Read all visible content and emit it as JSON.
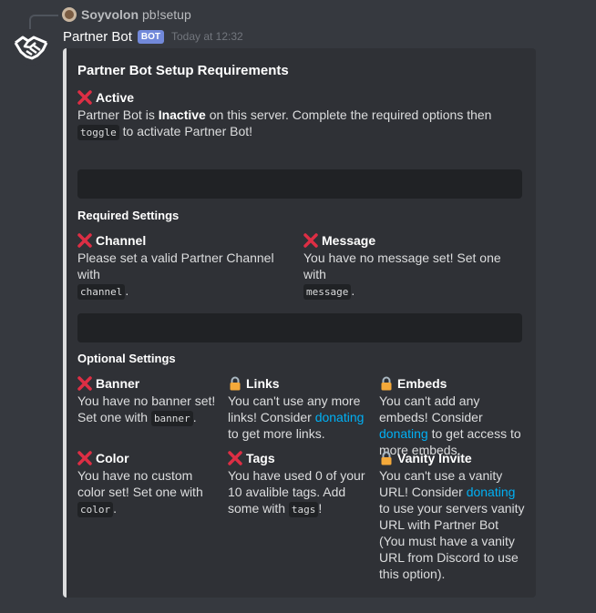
{
  "reply": {
    "author": "Soyvolon",
    "text": "pb!setup"
  },
  "message": {
    "author": "Partner Bot",
    "bot_tag": "BOT",
    "timestamp": "Today at 12:32"
  },
  "embed": {
    "title": "Partner Bot Setup Requirements",
    "active": {
      "name": "Active",
      "text_1": "Partner Bot is ",
      "status": "Inactive",
      "text_2": " on this server. Complete the required options then ",
      "code": "toggle",
      "text_3": " to activate Partner Bot!"
    },
    "required_heading": "Required Settings",
    "channel": {
      "name": "Channel",
      "text_1": "Please set a valid Partner Channel with",
      "code": "channel",
      "text_2": "."
    },
    "message_field": {
      "name": "Message",
      "text_1": "You have no message set! Set one with",
      "code": "message",
      "text_2": "."
    },
    "optional_heading": "Optional Settings",
    "banner": {
      "name": "Banner",
      "text_1": "You have no banner set! Set one with ",
      "code": "banner",
      "text_2": "."
    },
    "links": {
      "name": "Links",
      "text_1": "You can't use any more links! Consider ",
      "link": "donating",
      "text_2": " to get more links."
    },
    "embeds": {
      "name": "Embeds",
      "text_1": "You can't add any embeds! Consider ",
      "link": "donating",
      "text_2": " to get access to more embeds."
    },
    "color": {
      "name": "Color",
      "text_1": "You have no custom color set! Set one with ",
      "code": "color",
      "text_2": "."
    },
    "tags": {
      "name": "Tags",
      "text_1": "You have used 0 of your 10 avalible tags. Add some with ",
      "code": "tags",
      "text_2": "!"
    },
    "vanity": {
      "name": "Vanity Invite",
      "text_1": "You can't use a vanity URL! Consider ",
      "link": "donating",
      "text_2": " to use your servers vanity URL with Partner Bot (You must have a vanity URL from Discord to use this option)."
    }
  },
  "colors": {
    "background": "#36393f",
    "embed_background": "#2f3136",
    "link": "#00b0f4",
    "bot_tag": "#7289da",
    "x_red": "#dd2e44",
    "lock_gold": "#f4a93a"
  },
  "icons": {
    "x": "cross-mark-icon",
    "lock": "lock-icon",
    "avatar": "handshake-icon"
  }
}
